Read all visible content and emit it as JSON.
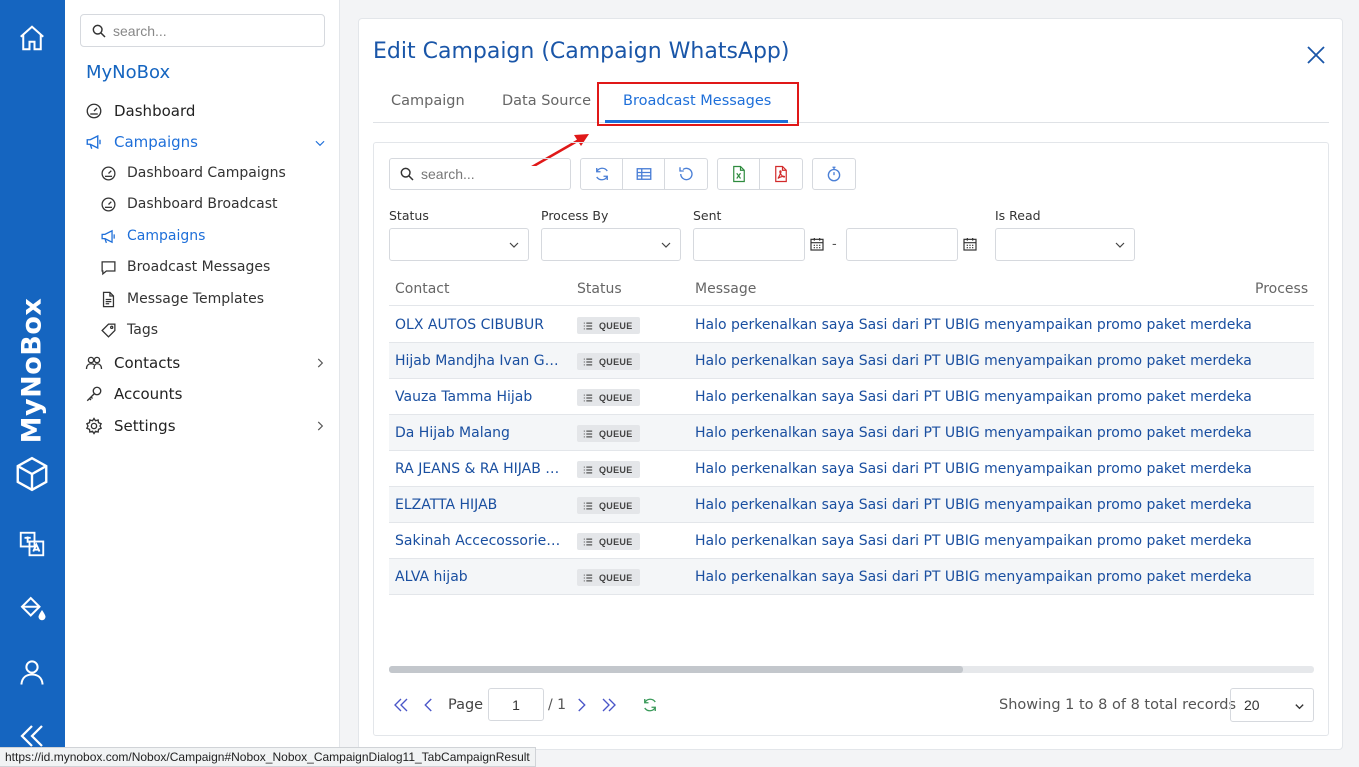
{
  "rail": {
    "brand": "MyNoBox",
    "icons": [
      "home-icon",
      "cube-logo-icon",
      "translate-icon",
      "paint-bucket-icon",
      "user-icon",
      "double-chevron-left-icon"
    ]
  },
  "sidebar": {
    "search_placeholder": "search...",
    "title": "MyNoBox",
    "items": {
      "dashboard": "Dashboard",
      "campaigns": "Campaigns",
      "dashboard_campaigns": "Dashboard Campaigns",
      "dashboard_broadcast": "Dashboard Broadcast",
      "campaigns_sub": "Campaigns",
      "broadcast_messages": "Broadcast Messages",
      "message_templates": "Message Templates",
      "tags": "Tags",
      "contacts": "Contacts",
      "accounts": "Accounts",
      "settings": "Settings"
    }
  },
  "dialog": {
    "title": "Edit Campaign (Campaign WhatsApp)",
    "tabs": [
      "Campaign",
      "Data Source",
      "Broadcast Messages"
    ],
    "active_tab": "Broadcast Messages",
    "search_placeholder": "search...",
    "filters": {
      "status": "Status",
      "process_by": "Process By",
      "sent": "Sent",
      "sent_separator": "-",
      "is_read": "Is Read"
    },
    "columns": [
      "Contact",
      "Status",
      "Message",
      "Process"
    ],
    "rows": [
      {
        "contact": "OLX AUTOS CIBUBUR",
        "status": "QUEUE",
        "message": "Halo perkenalkan saya Sasi dari PT UBIG menyampaikan promo paket merdeka"
      },
      {
        "contact": "Hijab Mandjha Ivan Gunawan",
        "status": "QUEUE",
        "message": "Halo perkenalkan saya Sasi dari PT UBIG menyampaikan promo paket merdeka"
      },
      {
        "contact": "Vauza Tamma Hijab",
        "status": "QUEUE",
        "message": "Halo perkenalkan saya Sasi dari PT UBIG menyampaikan promo paket merdeka"
      },
      {
        "contact": "Da Hijab Malang",
        "status": "QUEUE",
        "message": "Halo perkenalkan saya Sasi dari PT UBIG menyampaikan promo paket merdeka"
      },
      {
        "contact": "RA JEANS & RA HIJAB MALANG",
        "status": "QUEUE",
        "message": "Halo perkenalkan saya Sasi dari PT UBIG menyampaikan promo paket merdeka"
      },
      {
        "contact": "ELZATTA HIJAB",
        "status": "QUEUE",
        "message": "Halo perkenalkan saya Sasi dari PT UBIG menyampaikan promo paket merdeka"
      },
      {
        "contact": "Sakinah Accecossories Malang",
        "status": "QUEUE",
        "message": "Halo perkenalkan saya Sasi dari PT UBIG menyampaikan promo paket merdeka"
      },
      {
        "contact": "ALVA hijab",
        "status": "QUEUE",
        "message": "Halo perkenalkan saya Sasi dari PT UBIG menyampaikan promo paket merdeka"
      }
    ],
    "horizontal_scroll_fraction": 0.62,
    "pager": {
      "page_label": "Page",
      "page_value": "1",
      "page_of": "/ 1",
      "info": "Showing 1 to 8 of 8 total records",
      "page_size": "20"
    }
  },
  "statusbar": {
    "url": "https://id.mynobox.com/Nobox/Campaign#Nobox_Nobox_CampaignDialog11_TabCampaignResult"
  },
  "colors": {
    "rail": "#1565c0",
    "accent": "#1e6fd9",
    "link": "#1a4fa0",
    "highlight": "#e01818"
  }
}
